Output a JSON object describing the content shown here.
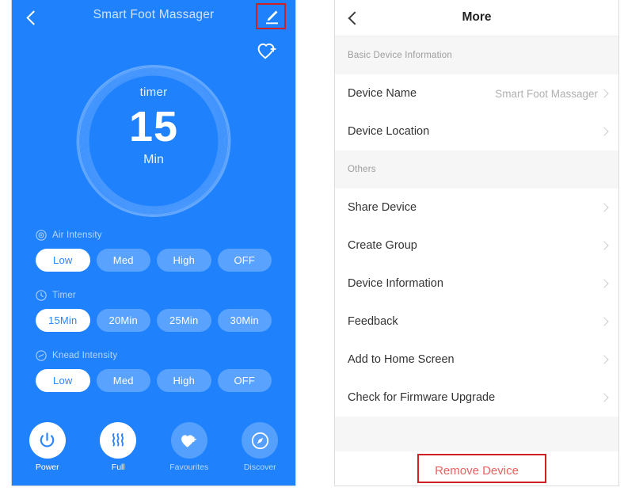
{
  "device_screen": {
    "header": {
      "back_icon": "chevron-left-icon",
      "title": "Smart Foot Massager",
      "edit_icon": "pencil-edit-icon",
      "edit_highlight_color": "#cf2026"
    },
    "favourite_icon": "heart-plus-icon",
    "dial": {
      "label": "timer",
      "value": "15",
      "unit": "Min"
    },
    "groups": [
      {
        "icon": "target-circle-icon",
        "label": "Air Intensity",
        "options": [
          {
            "label": "Low",
            "active": true
          },
          {
            "label": "Med",
            "active": false
          },
          {
            "label": "High",
            "active": false
          },
          {
            "label": "OFF",
            "active": false
          }
        ]
      },
      {
        "icon": "clock-icon",
        "label": "Timer",
        "options": [
          {
            "label": "15Min",
            "active": true
          },
          {
            "label": "20Min",
            "active": false
          },
          {
            "label": "25Min",
            "active": false
          },
          {
            "label": "30Min",
            "active": false
          }
        ]
      },
      {
        "icon": "knead-circle-icon",
        "label": "Knead Intensity",
        "options": [
          {
            "label": "Low",
            "active": true
          },
          {
            "label": "Med",
            "active": false
          },
          {
            "label": "High",
            "active": false
          },
          {
            "label": "OFF",
            "active": false
          }
        ]
      }
    ],
    "nav": [
      {
        "icon": "power-icon",
        "label": "Power",
        "active": true
      },
      {
        "icon": "waves-icon",
        "label": "Full",
        "active": true
      },
      {
        "icon": "heart-plus-icon",
        "label": "Favourites",
        "active": false
      },
      {
        "icon": "compass-icon",
        "label": "Discover",
        "active": false
      }
    ],
    "theme": {
      "background": "#1f82fc",
      "active_pill_text": "#2b86fd"
    }
  },
  "more_screen": {
    "header": {
      "back_icon": "chevron-left-icon",
      "title": "More"
    },
    "sections": [
      {
        "heading": "Basic Device Information",
        "rows": [
          {
            "label": "Device Name",
            "value": "Smart Foot Massager",
            "chevron": "chevron-right-icon"
          },
          {
            "label": "Device Location",
            "value": "",
            "chevron": "chevron-right-icon"
          }
        ]
      },
      {
        "heading": "Others",
        "rows": [
          {
            "label": "Share Device",
            "value": "",
            "chevron": "chevron-right-icon"
          },
          {
            "label": "Create Group",
            "value": "",
            "chevron": "chevron-right-icon"
          },
          {
            "label": "Device Information",
            "value": "",
            "chevron": "chevron-right-icon"
          },
          {
            "label": "Feedback",
            "value": "",
            "chevron": "chevron-right-icon"
          },
          {
            "label": "Add to Home Screen",
            "value": "",
            "chevron": "chevron-right-icon"
          },
          {
            "label": "Check for Firmware Upgrade",
            "value": "",
            "chevron": "chevron-right-icon"
          }
        ]
      }
    ],
    "remove": {
      "label": "Remove Device",
      "text_color": "#e8615f",
      "highlight_color": "#cf2026"
    }
  }
}
